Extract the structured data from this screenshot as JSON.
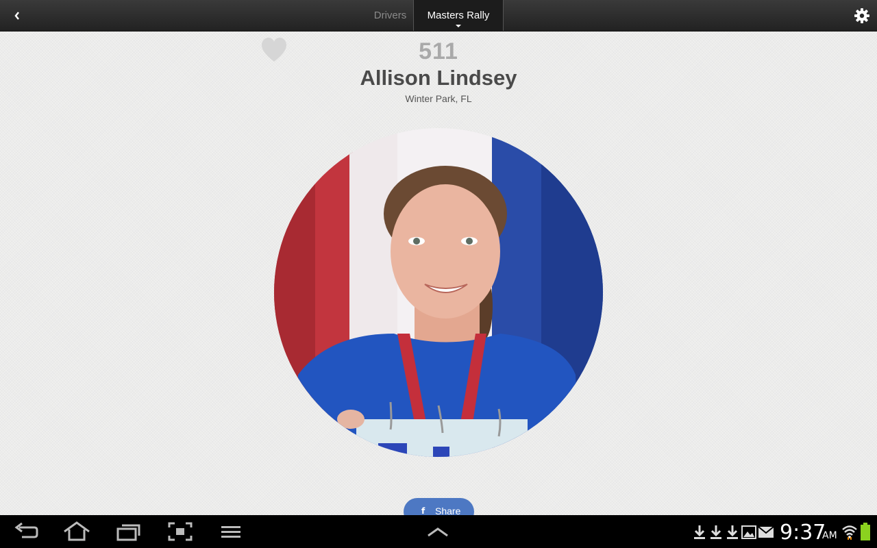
{
  "header": {
    "back_icon": "chevron-left-icon",
    "tabs": [
      {
        "label": "Drivers",
        "active": false
      },
      {
        "label": "Masters Rally",
        "active": true
      }
    ],
    "settings_icon": "gear-icon"
  },
  "profile": {
    "favorite_icon": "heart-icon",
    "number": "511",
    "name": "Allison Lindsey",
    "location": "Winter Park, FL",
    "photo_icon": "driver-photo"
  },
  "share": {
    "icon": "facebook-icon",
    "label": "Share",
    "color": "#4d78c3"
  },
  "system_bar": {
    "time": "9:37",
    "ampm": "AM",
    "battery_color": "#8bd21f",
    "icons": [
      "back-icon",
      "home-icon",
      "recent-apps-icon",
      "screenshot-icon",
      "menu-icon",
      "expand-up-icon",
      "download-icon",
      "download-icon",
      "download-icon",
      "gallery-icon",
      "gmail-icon",
      "wifi-icon",
      "battery-icon"
    ]
  }
}
